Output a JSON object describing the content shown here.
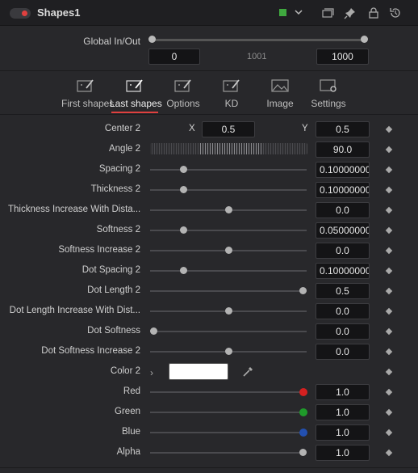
{
  "header": {
    "title": "Shapes1",
    "color_tag": "#3fa83f"
  },
  "global": {
    "label": "Global In/Out",
    "in_value": "0",
    "mid_value": "1001",
    "out_value": "1000"
  },
  "tabs": [
    {
      "label": "First shapes",
      "icon": "paint-brush-icon",
      "active": false
    },
    {
      "label": "Last shapes",
      "icon": "paint-brush-icon",
      "active": true
    },
    {
      "label": "Options",
      "icon": "paint-brush-icon",
      "active": false
    },
    {
      "label": "KD",
      "icon": "paint-brush-icon",
      "active": false
    },
    {
      "label": "Image",
      "icon": "image-icon",
      "active": false
    },
    {
      "label": "Settings",
      "icon": "gear-window-icon",
      "active": false
    }
  ],
  "params": {
    "center": {
      "label": "Center 2",
      "x_label": "X",
      "x": "0.5",
      "y_label": "Y",
      "y": "0.5"
    },
    "angle": {
      "label": "Angle 2",
      "value": "90.0"
    },
    "spacing": {
      "label": "Spacing 2",
      "value": "0.10000000",
      "level": 0.2
    },
    "thickness": {
      "label": "Thickness 2",
      "value": "0.10000000",
      "level": 0.2
    },
    "thickness_increase": {
      "label": "Thickness Increase With Dista...",
      "value": "0.0",
      "level": 0.5
    },
    "softness": {
      "label": "Softness 2",
      "value": "0.05000000",
      "level": 0.2
    },
    "softness_increase": {
      "label": "Softness Increase 2",
      "value": "0.0",
      "level": 0.5
    },
    "dot_spacing": {
      "label": "Dot Spacing 2",
      "value": "0.10000000",
      "level": 0.2
    },
    "dot_length": {
      "label": "Dot Length 2",
      "value": "0.5",
      "level": 1.0
    },
    "dot_length_increase": {
      "label": "Dot Length Increase With Dist...",
      "value": "0.0",
      "level": 0.5
    },
    "dot_softness": {
      "label": "Dot Softness",
      "value": "0.0",
      "level": 0.0
    },
    "dot_softness_increase": {
      "label": "Dot Softness Increase 2",
      "value": "0.0",
      "level": 0.5
    },
    "color": {
      "label": "Color 2",
      "swatch": "#ffffff"
    },
    "red": {
      "label": "Red",
      "value": "1.0",
      "level": 1.0,
      "dot": "#d42020"
    },
    "green": {
      "label": "Green",
      "value": "1.0",
      "level": 1.0,
      "dot": "#1f9a2a"
    },
    "blue": {
      "label": "Blue",
      "value": "1.0",
      "level": 1.0,
      "dot": "#2350b0"
    },
    "alpha": {
      "label": "Alpha",
      "value": "1.0",
      "level": 1.0,
      "dot": "#b3b3b3"
    }
  }
}
